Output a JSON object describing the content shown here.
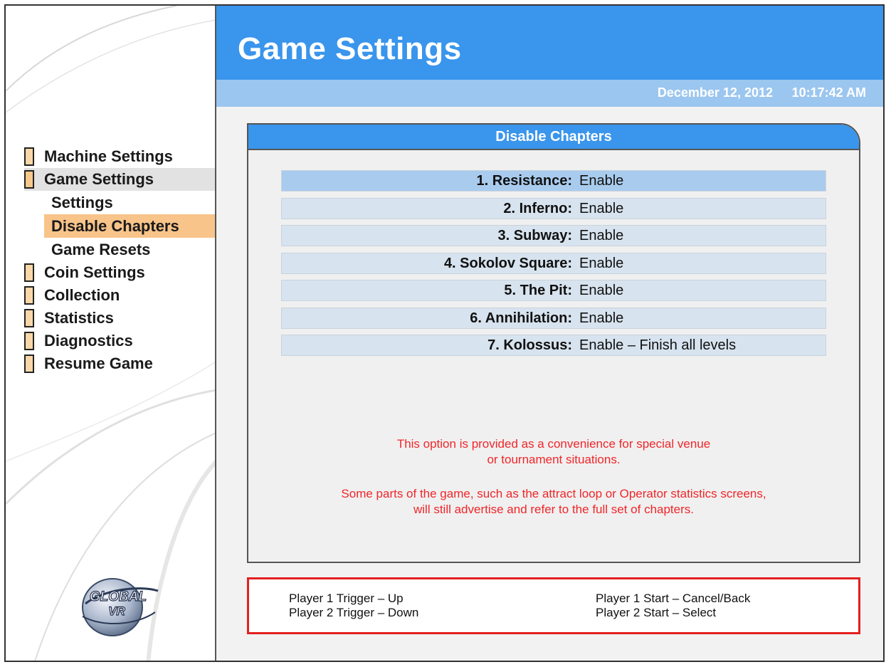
{
  "header": {
    "title": "Game Settings",
    "date": "December 12, 2012",
    "time": "10:17:42 AM"
  },
  "sidebar": {
    "items": [
      {
        "label": "Machine Settings"
      },
      {
        "label": "Game Settings"
      },
      {
        "label": "Coin Settings"
      },
      {
        "label": "Collection"
      },
      {
        "label": "Statistics"
      },
      {
        "label": "Diagnostics"
      },
      {
        "label": "Resume Game"
      }
    ],
    "subitems": [
      {
        "label": "Settings"
      },
      {
        "label": "Disable Chapters"
      },
      {
        "label": "Game Resets"
      }
    ],
    "logo_text": "GLOBAL VR"
  },
  "panel": {
    "title": "Disable Chapters",
    "rows": [
      {
        "label": "1. Resistance:",
        "value": "Enable"
      },
      {
        "label": "2. Inferno:",
        "value": "Enable"
      },
      {
        "label": "3. Subway:",
        "value": "Enable"
      },
      {
        "label": "4. Sokolov Square:",
        "value": "Enable"
      },
      {
        "label": "5. The Pit:",
        "value": "Enable"
      },
      {
        "label": "6. Annihilation:",
        "value": "Enable"
      },
      {
        "label": "7. Kolossus:",
        "value": "Enable – Finish all levels"
      }
    ],
    "notice1_line1": "This option is provided as a convenience for special venue",
    "notice1_line2": "or tournament situations.",
    "notice2_line1": "Some parts of the game, such as the attract loop or Operator statistics screens,",
    "notice2_line2": "will still advertise and refer to the full set of chapters."
  },
  "controls": {
    "p1_trigger": "Player 1 Trigger – Up",
    "p2_trigger": "Player 2 Trigger – Down",
    "p1_start": "Player 1 Start – Cancel/Back",
    "p2_start": "Player 2 Start – Select"
  },
  "colors": {
    "header_blue": "#3a95ec",
    "subheader_blue": "#9bc6ef",
    "selected_orange": "#f8c48a",
    "notice_red": "#f0262a"
  }
}
